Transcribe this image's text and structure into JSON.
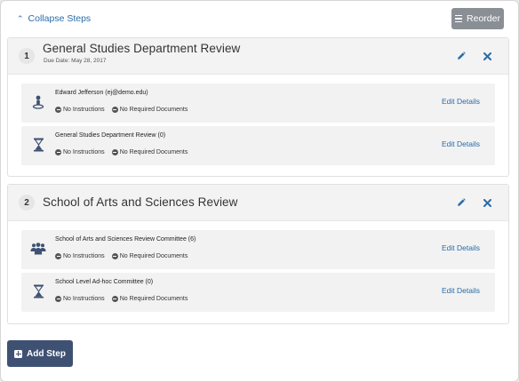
{
  "toolbar": {
    "collapse_label": "Collapse Steps",
    "reorder_label": "Reorder"
  },
  "steps": [
    {
      "number": "1",
      "title": "General Studies Department Review",
      "due": "Due Date: May 28, 2017",
      "members": [
        {
          "icon": "person-icon",
          "name": "Edward Jefferson (ej@demo.edu)",
          "instructions": "No Instructions",
          "documents": "No Required Documents",
          "action": "Edit Details"
        },
        {
          "icon": "hourglass-icon",
          "name": "General Studies Department Review (0)",
          "instructions": "No Instructions",
          "documents": "No Required Documents",
          "action": "Edit Details"
        }
      ]
    },
    {
      "number": "2",
      "title": "School of Arts and Sciences Review",
      "members": [
        {
          "icon": "group-icon",
          "name": "School of Arts and Sciences Review Committee (6)",
          "instructions": "No Instructions",
          "documents": "No Required Documents",
          "action": "Edit Details"
        },
        {
          "icon": "hourglass-icon",
          "name": "School Level Ad-hoc Committee (0)",
          "instructions": "No Instructions",
          "documents": "No Required Documents",
          "action": "Edit Details"
        }
      ]
    }
  ],
  "footer": {
    "add_step_label": "Add Step"
  },
  "colors": {
    "link": "#2a6ca8",
    "icon_blue": "#3f5173",
    "reorder_bg": "#8a8f96",
    "add_step_bg": "#3f5173"
  }
}
